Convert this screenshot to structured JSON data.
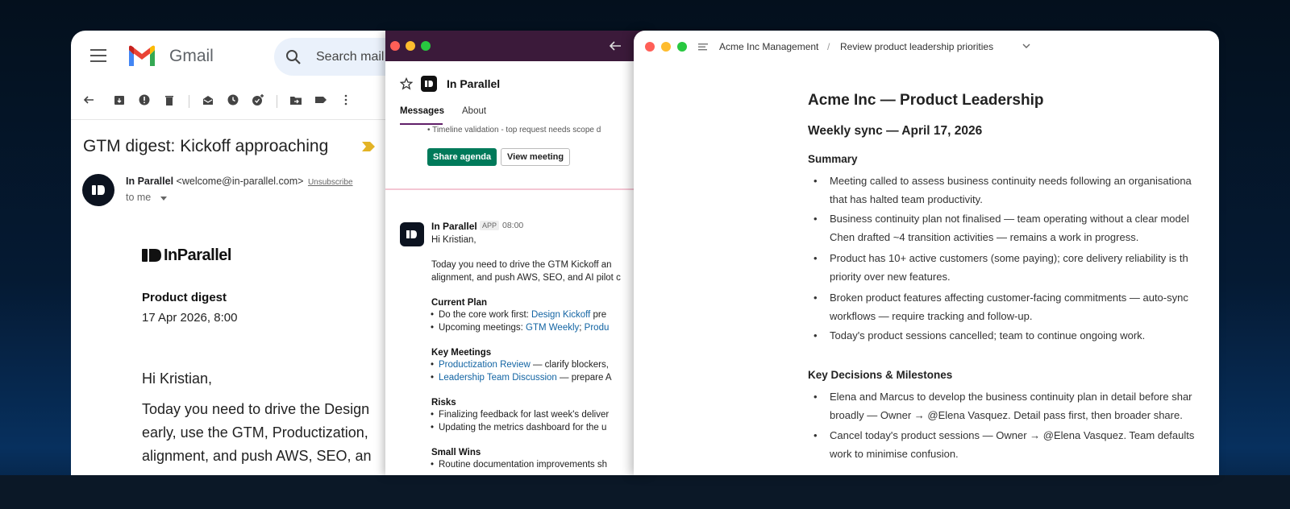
{
  "gmail": {
    "brand": "Gmail",
    "search_placeholder": "Search mail",
    "subject": "GTM digest: Kickoff approaching",
    "sender_name": "In Parallel",
    "sender_email": "<welcome@in-parallel.com>",
    "unsubscribe": "Unsubscribe",
    "to_me": "to me",
    "logo_text": "InParallel",
    "digest_title": "Product digest",
    "digest_date": "17 Apr 2026, 8:00",
    "greeting": "Hi Kristian,",
    "body_lines": [
      "Today you need to drive the Design",
      "early, use the GTM, Productization,",
      "alignment, and push AWS, SEO, an"
    ],
    "toolbar_icons": [
      "back-arrow-icon",
      "archive-icon",
      "report-spam-icon",
      "delete-icon",
      "mark-unread-icon",
      "snooze-icon",
      "add-task-icon",
      "move-to-icon",
      "label-icon",
      "more-vert-icon"
    ]
  },
  "slack": {
    "channel_name": "In Parallel",
    "tabs": [
      "Messages",
      "About"
    ],
    "top_bullet": "• Timeline validation - top request needs scope d",
    "share_button": "Share agenda",
    "view_button": "View meeting",
    "message": {
      "author": "In Parallel",
      "badge": "APP",
      "time": "08:00",
      "greeting": "Hi Kristian,",
      "intro_lines": [
        "Today you need to drive the GTM Kickoff an",
        "alignment, and push AWS, SEO, and AI pilot c"
      ],
      "current_plan": {
        "heading": "Current Plan",
        "item1_prefix": "Do the core work first: ",
        "item1_link": "Design Kickoff",
        "item1_suffix": " pre",
        "item2_prefix": "Upcoming meetings: ",
        "item2_link1": "GTM Weekly",
        "item2_mid": "; ",
        "item2_link2": "Produ"
      },
      "key_meetings": {
        "heading": "Key Meetings",
        "item1_link": "Productization Review",
        "item1_suffix": " — clarify blockers,",
        "item2_link": "Leadership Team Discussion",
        "item2_suffix": " — prepare A"
      },
      "risks": {
        "heading": "Risks",
        "items": [
          "Finalizing feedback for last week's deliver",
          "Updating the metrics dashboard for the u"
        ]
      },
      "small_wins": {
        "heading": "Small Wins",
        "items": [
          "Routine documentation improvements sh"
        ]
      }
    }
  },
  "notes": {
    "breadcrumb": [
      "Acme Inc Management",
      "Review product leadership priorities"
    ],
    "breadcrumb_sep": "/",
    "title": "Acme Inc — Product Leadership",
    "subtitle": "Weekly sync — April 17, 2026",
    "summary_heading": "Summary",
    "summary_items": [
      [
        "Meeting called to assess business continuity needs following an organisationa",
        "that has halted team productivity."
      ],
      [
        "Business continuity plan not finalised — team operating without a clear model",
        "Chen drafted ~4 transition activities — remains a work in progress."
      ],
      [
        "Product has 10+ active customers (some paying); core delivery reliability is th",
        "priority over new features."
      ],
      [
        "Broken product features affecting customer-facing commitments — auto-sync",
        "workflows — require tracking and follow-up."
      ],
      [
        "Today's product sessions cancelled; team to continue ongoing work."
      ]
    ],
    "decisions_heading": "Key Decisions & Milestones",
    "decision_items": [
      [
        "Elena and Marcus to develop the business continuity plan in detail before shar",
        "broadly — Owner → @Elena Vasquez. Detail pass first, then broader share."
      ],
      [
        "Cancel today's product sessions — Owner → @Elena Vasquez. Team defaults",
        "work to minimise confusion."
      ]
    ]
  },
  "colors": {
    "slack_titlebar": "#3b1a3a",
    "slack_green": "#007a5a",
    "slack_link": "#1264a3",
    "gmail_search_bg": "#eaf1fb"
  }
}
